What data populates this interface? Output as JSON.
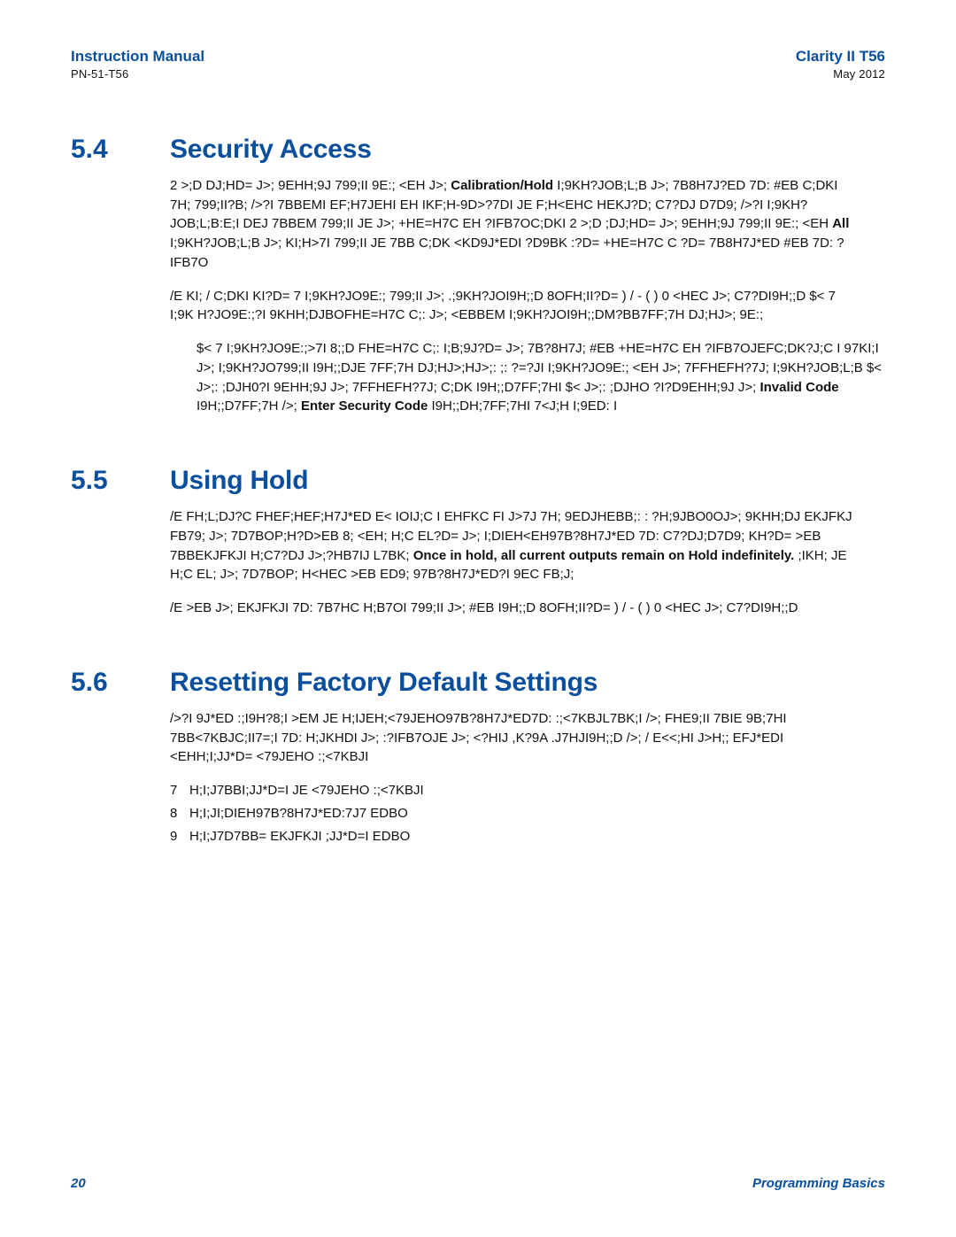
{
  "header": {
    "left_title": "Instruction Manual",
    "left_sub": "PN-51-T56",
    "right_title": "Clarity II T56",
    "right_sub": "May 2012"
  },
  "sec54": {
    "num": "5.4",
    "title": "Security Access",
    "p1_1": "2 >;D DJ;HD= J>; 9EHH;9J 799;II 9E:; <EH J>; ",
    "p1_bold1": "Calibration/Hold",
    "p1_2": " I;9KH?JOB;L;B J>;  7B8H7J?ED 7D: #EB C;DKI 7H; 799;II?B; />?I 7BBEMI EF;H7JEHI EH IKF;H-9D>?7DI JE F;H<EHC HEKJ?D; C7?DJ D7D9; />?I I;9KH?JOB;L;B:E;I DEJ 7BBEM 799;II JE J>; +HE=H7C EH  ?IFB7OC;DKI 2 >;D ;DJ;HD= J>; 9EHH;9J 799;II 9E:; <EH ",
    "p1_bold2": "All",
    "p1_3": " I;9KH?JOB;L;B J>; KI;H>7I 799;II JE 7BB C;DK <KD9J*EDI ?D9BK :?D= +HE=H7C C ?D=  7B8H7J*ED #EB 7D:  ?IFB7O",
    "p2": "/E KI; /  C;DKI KI?D= 7 I;9KH?JO9E:; 799;II J>; .;9KH?JOI9H;;D 8OFH;II?D=  ) / - (  ) 0 <HEC J>; C7?DI9H;;D $< 7 I;9K H?JO9E:;?I 9KHH;DJBOFHE=H7C C;: J>; <EBBEM I;9KH?JOI9H;;DM?BB7FF;7H DJ;HJ>; 9E:;",
    "p3_indent": "$< 7 I;9KH?JO9E:;>7I 8;;D FHE=H7C C;: I;B;9J?D= J>;  7B?8H7J; #EB +HE=H7C EH ?IFB7OJEFC;DK?J;C I 97KI;I J>; I;9KH?JO799;II I9H;;DJE 7FF;7H DJ;HJ>;HJ>;: ;: ?=?JI I;9KH?JO9E:; <EH J>; 7FFHEFH?7J; I;9KH?JOB;L;B $< J>;: ;DJH0?I 9EHH;9J J>; 7FFHEFH?7J; C;DK I9H;;D7FF;7HI $< J>;: ;DJHO ?I?D9EHH;9J J>;",
    "p3_bold1": "Invalid Code",
    "p3_after1": " I9H;;D7FF;7H />; ",
    "p3_bold2": "Enter Security Code",
    "p3_after2": " I9H;;DH;7FF;7HI 7<J;H  I;9ED: I"
  },
  "sec55": {
    "num": "5.5",
    "title": "Using Hold",
    "p1_1": "/E FH;L;DJ?C FHEF;HEF;H7J*ED E< IOIJ;C I EHFKC FI J>7J 7H; 9EDJHEBB;: : ?H;9JBO0OJ>; 9KHH;DJ EKJFKJ FB79; J>; 7D7BOP;H?D>EB 8; <EH; H;C EL?D= J>; I;DIEH<EH97B?8H7J*ED 7D: C7?DJ;D7D9;  KH?D= >EB  7BBEKJFKJI H;C7?DJ J>;?HB7IJ L7BK;  ",
    "p1_bold": "Once in hold, all current outputs remain on Hold indefinitely.",
    "p1_2": " ;IKH; JE H;C EL; J>; 7D7BOP; H<HEC >EB ED9; 97B?8H7J*ED?I 9EC FB;J;",
    "p2": "/E >EB J>; EKJFKJI 7D: 7B7HC H;B7OI 799;II J>; #EB I9H;;D 8OFH;II?D=  ) / - (  ) 0 <HEC J>; C7?DI9H;;D"
  },
  "sec56": {
    "num": "5.6",
    "title": "Resetting Factory Default Settings",
    "p1": "/>?I 9J*ED :;I9H?8;I >EM JE H;IJEH;<79JEHO97B?8H7J*ED7D: :;<7KBJL7BK;I />; FHE9;II 7BIE 9B;7HI 7BB<7KBJC;II7=;I 7D: H;JKHDI J>; :?IFB7OJE J>; <?HIJ ,K?9A .J7HJI9H;;D />; /   E<<;HI J>H;; EFJ*EDI <EHH;I;JJ*D= <79JEHO :;<7KBJI",
    "list": {
      "a_marker": "7",
      "a_text": "H;I;J7BBI;JJ*D=I JE <79JEHO :;<7KBJI",
      "b_marker": "8",
      "b_text": "H;I;JI;DIEH97B?8H7J*ED:7J7 EDBO",
      "c_marker": "9",
      "c_text": "H;I;J7D7BB= EKJFKJI ;JJ*D=I EDBO"
    }
  },
  "footer": {
    "pagenum": "20",
    "label": "Programming Basics"
  }
}
